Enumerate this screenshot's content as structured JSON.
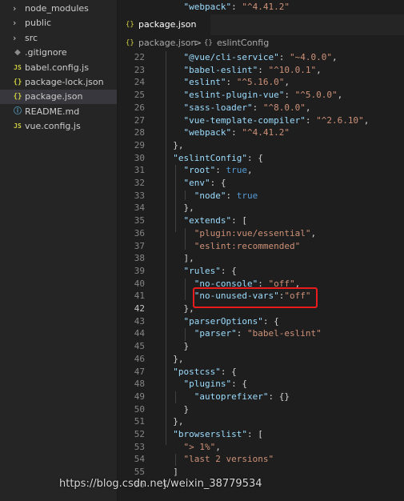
{
  "sidebar": {
    "items": [
      {
        "label": "node_modules",
        "icon": "chevron-right-icon",
        "kind": "folder"
      },
      {
        "label": "public",
        "icon": "chevron-right-icon",
        "kind": "folder"
      },
      {
        "label": "src",
        "icon": "chevron-right-icon",
        "kind": "folder"
      },
      {
        "label": ".gitignore",
        "icon": "git-icon",
        "kind": "git"
      },
      {
        "label": "babel.config.js",
        "icon": "js-file-icon",
        "kind": "js"
      },
      {
        "label": "package-lock.json",
        "icon": "json-file-icon",
        "kind": "json"
      },
      {
        "label": "package.json",
        "icon": "json-file-icon",
        "kind": "json",
        "selected": true
      },
      {
        "label": "README.md",
        "icon": "info-icon",
        "kind": "info"
      },
      {
        "label": "vue.config.js",
        "icon": "js-file-icon",
        "kind": "js"
      }
    ]
  },
  "tab": {
    "label": "package.json",
    "icon": "{}"
  },
  "breadcrumb": {
    "file": "package.json",
    "separator": ">",
    "symbol": "eslintConfig",
    "file_icon": "{}",
    "symbol_icon": "{}"
  },
  "code": {
    "top_line": {
      "num": "28",
      "text": "    \"webpack\": \"^4.41.2\""
    },
    "lines": [
      {
        "num": "22",
        "text": "    \"@vue/cli-service\": \"~4.0.0\","
      },
      {
        "num": "23",
        "text": "    \"babel-eslint\": \"^10.0.1\","
      },
      {
        "num": "24",
        "text": "    \"eslint\": \"^5.16.0\","
      },
      {
        "num": "25",
        "text": "    \"eslint-plugin-vue\": \"^5.0.0\","
      },
      {
        "num": "26",
        "text": "    \"sass-loader\": \"^8.0.0\","
      },
      {
        "num": "27",
        "text": "    \"vue-template-compiler\": \"^2.6.10\","
      },
      {
        "num": "28",
        "text": "    \"webpack\": \"^4.41.2\""
      },
      {
        "num": "29",
        "text": "  },"
      },
      {
        "num": "30",
        "text": "  \"eslintConfig\": {"
      },
      {
        "num": "31",
        "text": "    \"root\": true,"
      },
      {
        "num": "32",
        "text": "    \"env\": {"
      },
      {
        "num": "33",
        "text": "      \"node\": true"
      },
      {
        "num": "34",
        "text": "    },"
      },
      {
        "num": "35",
        "text": "    \"extends\": ["
      },
      {
        "num": "36",
        "text": "      \"plugin:vue/essential\","
      },
      {
        "num": "37",
        "text": "      \"eslint:recommended\""
      },
      {
        "num": "38",
        "text": "    ],"
      },
      {
        "num": "39",
        "text": "    \"rules\": {"
      },
      {
        "num": "40",
        "text": "      \"no-console\": \"off\","
      },
      {
        "num": "41",
        "text": "      \"no-unused-vars\":\"off\""
      },
      {
        "num": "42",
        "text": "    },"
      },
      {
        "num": "43",
        "text": "    \"parserOptions\": {"
      },
      {
        "num": "44",
        "text": "      \"parser\": \"babel-eslint\""
      },
      {
        "num": "45",
        "text": "    }"
      },
      {
        "num": "46",
        "text": "  },"
      },
      {
        "num": "47",
        "text": "  \"postcss\": {"
      },
      {
        "num": "48",
        "text": "    \"plugins\": {"
      },
      {
        "num": "49",
        "text": "      \"autoprefixer\": {}"
      },
      {
        "num": "50",
        "text": "    }"
      },
      {
        "num": "51",
        "text": "  },"
      },
      {
        "num": "52",
        "text": "  \"browserslist\": ["
      },
      {
        "num": "53",
        "text": "    \"> 1%\","
      },
      {
        "num": "54",
        "text": "    \"last 2 versions\""
      },
      {
        "num": "55",
        "text": "  ]"
      },
      {
        "num": "56",
        "text": "}"
      }
    ],
    "current_line": "42",
    "highlighted_line": "41"
  },
  "watermark": "https://blog.csdn.net/weixin_38779534",
  "colors": {
    "key": "#9cdcfe",
    "string": "#ce9178",
    "boolean": "#569cd6",
    "punct": "#d4d4d4",
    "highlight_box": "#e81c1c",
    "editor_bg": "#1e1e1e",
    "sidebar_bg": "#252526"
  }
}
